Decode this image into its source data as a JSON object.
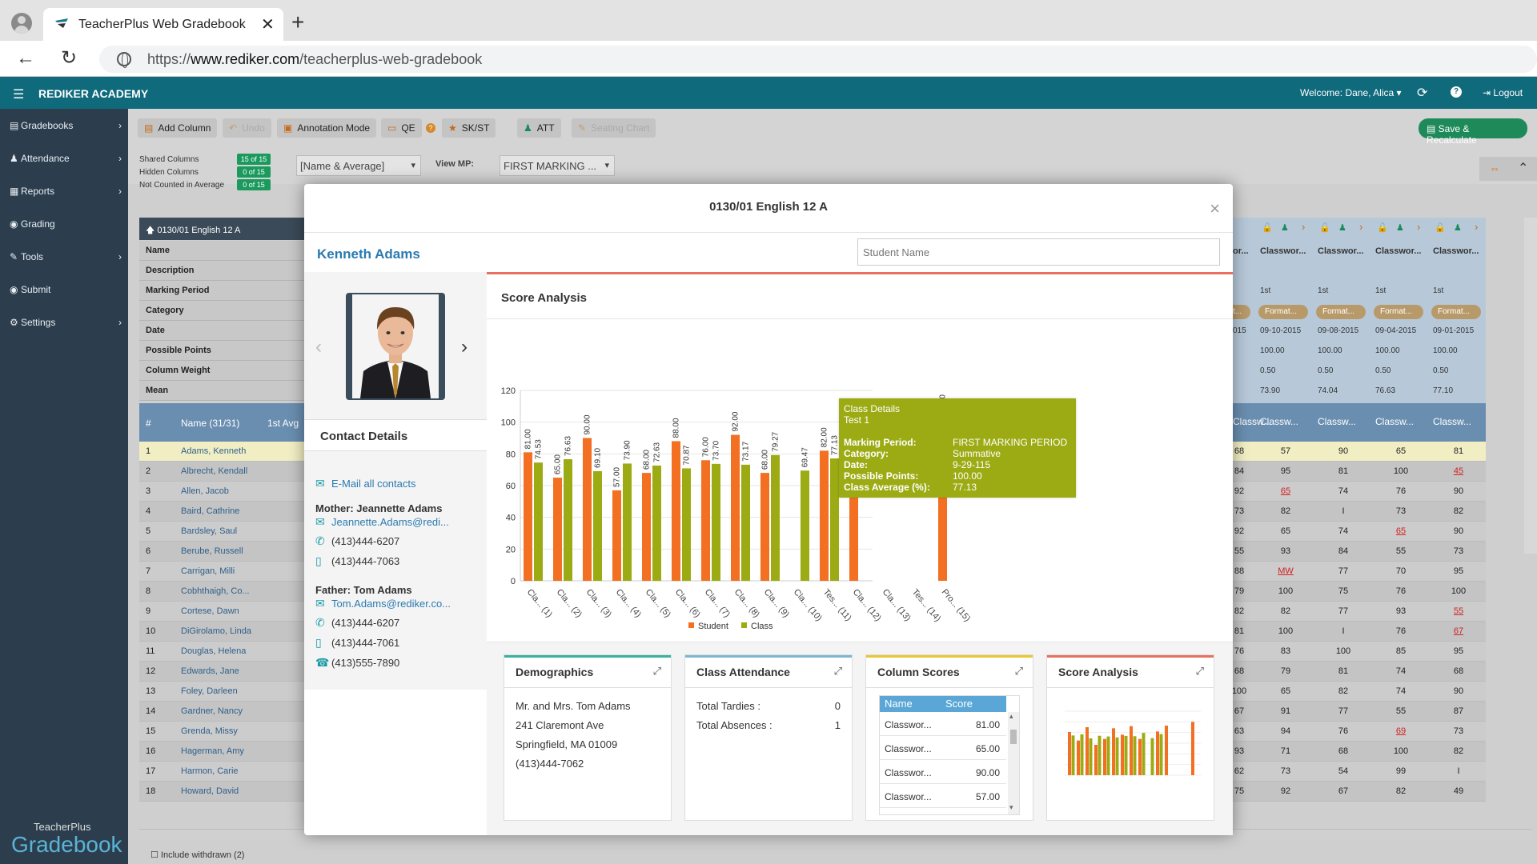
{
  "browser": {
    "tab_title": "TeacherPlus Web Gradebook - O",
    "url_prefix": "https://",
    "url_domain": "www.rediker.com",
    "url_path": "/teacherplus-web-gradebook"
  },
  "header": {
    "school": "REDIKER ACADEMY",
    "welcome": "Welcome: Dane, Alica ▾",
    "logout": "Logout"
  },
  "sidebar": {
    "items": [
      {
        "label": "Gradebooks",
        "icon": "book-icon",
        "glyph": "▤",
        "chevron": true
      },
      {
        "label": "Attendance",
        "icon": "user-icon",
        "glyph": "♟",
        "chevron": true
      },
      {
        "label": "Reports",
        "icon": "report-icon",
        "glyph": "▦",
        "chevron": true
      },
      {
        "label": "Grading",
        "icon": "grading-icon",
        "glyph": "◉",
        "chevron": false
      },
      {
        "label": "Tools",
        "icon": "wrench-icon",
        "glyph": "✎",
        "chevron": true
      },
      {
        "label": "Submit",
        "icon": "submit-icon",
        "glyph": "◉",
        "chevron": false
      },
      {
        "label": "Settings",
        "icon": "gear-icon",
        "glyph": "⚙",
        "chevron": true
      }
    ],
    "brand_small": "TeacherPlus",
    "brand_large": "Gradebook"
  },
  "toolbar": {
    "add_column": "Add Column",
    "undo": "Undo",
    "annotation": "Annotation Mode",
    "qe": "QE",
    "skst": "SK/ST",
    "att": "ATT",
    "seating": "Seating Chart",
    "save": "Save & Recalculate"
  },
  "options": {
    "shared_label": "Shared Columns",
    "shared_badge": "15 of 15",
    "hidden_label": "Hidden Columns",
    "hidden_badge": "0 of 15",
    "notcounted_label": "Not Counted in Average",
    "notcounted_badge": "0 of 15",
    "display_select": "[Name & Average]",
    "viewmp_label": "View MP:",
    "viewmp_select": "FIRST MARKING ..."
  },
  "grid": {
    "class_header": "0130/01 English 12 A",
    "row_labels": [
      "Name",
      "Description",
      "Marking Period",
      "Category",
      "Date",
      "Possible Points",
      "Column Weight",
      "Mean"
    ],
    "col_hash": "#",
    "col_name": "Name (31/31)",
    "col_avg": "1st Avg",
    "students": [
      {
        "n": "1",
        "name": "Adams, Kenneth"
      },
      {
        "n": "2",
        "name": "Albrecht, Kendall"
      },
      {
        "n": "3",
        "name": "Allen, Jacob"
      },
      {
        "n": "4",
        "name": "Baird, Cathrine"
      },
      {
        "n": "5",
        "name": "Bardsley, Saul"
      },
      {
        "n": "6",
        "name": "Berube, Russell"
      },
      {
        "n": "7",
        "name": "Carrigan, Milli"
      },
      {
        "n": "8",
        "name": "Cobhthaigh, Co..."
      },
      {
        "n": "9",
        "name": "Cortese, Dawn"
      },
      {
        "n": "10",
        "name": "DiGirolamo, Linda"
      },
      {
        "n": "11",
        "name": "Douglas, Helena"
      },
      {
        "n": "12",
        "name": "Edwards, Jane"
      },
      {
        "n": "13",
        "name": "Foley, Darleen"
      },
      {
        "n": "14",
        "name": "Gardner, Nancy"
      },
      {
        "n": "15",
        "name": "Grenda, Missy"
      },
      {
        "n": "16",
        "name": "Hagerman, Amy"
      },
      {
        "n": "17",
        "name": "Harmon, Carie"
      },
      {
        "n": "18",
        "name": "Howard, David"
      }
    ],
    "right_columns": [
      {
        "title": "Classwor...",
        "mp": "1st",
        "cat": "Format...",
        "date": "09-10-2015",
        "pts": "100.00",
        "wt": "0.50",
        "mean": "73.90",
        "head": "Classw..."
      },
      {
        "title": "Classwor...",
        "mp": "1st",
        "cat": "Format...",
        "date": "09-08-2015",
        "pts": "100.00",
        "wt": "0.50",
        "mean": "74.04",
        "head": "Classw..."
      },
      {
        "title": "Classwor...",
        "mp": "1st",
        "cat": "Format...",
        "date": "09-04-2015",
        "pts": "100.00",
        "wt": "0.50",
        "mean": "76.63",
        "head": "Classw..."
      },
      {
        "title": "Classwor...",
        "mp": "1st",
        "cat": "Format...",
        "date": "09-01-2015",
        "pts": "100.00",
        "wt": "0.50",
        "mean": "77.10",
        "head": "Classw..."
      }
    ],
    "partial_col": {
      "title": "or...",
      "cat": "t...",
      "date": "015",
      "head": "Classw..."
    },
    "partial_scores": [
      "68",
      "84",
      "92",
      "73",
      "92",
      "55",
      "88",
      "79",
      "82",
      "81",
      "76",
      "68",
      "100",
      "67",
      "63",
      "93",
      "62",
      "75"
    ],
    "scores": [
      [
        "57",
        "90",
        "65",
        "81"
      ],
      [
        "95",
        "81",
        "100",
        "45"
      ],
      [
        "65",
        "74",
        "76",
        "90"
      ],
      [
        "82",
        "I",
        "73",
        "82"
      ],
      [
        "65",
        "74",
        "65",
        "90"
      ],
      [
        "93",
        "84",
        "55",
        "73"
      ],
      [
        "MW",
        "77",
        "70",
        "95"
      ],
      [
        "100",
        "75",
        "76",
        "100"
      ],
      [
        "82",
        "77",
        "93",
        "55"
      ],
      [
        "100",
        "I",
        "76",
        "67"
      ],
      [
        "83",
        "100",
        "85",
        "95"
      ],
      [
        "79",
        "81",
        "74",
        "68"
      ],
      [
        "65",
        "82",
        "74",
        "90"
      ],
      [
        "91",
        "77",
        "55",
        "87"
      ],
      [
        "94",
        "76",
        "69",
        "73"
      ],
      [
        "71",
        "68",
        "100",
        "82"
      ],
      [
        "73",
        "54",
        "99",
        "I"
      ],
      [
        "92",
        "67",
        "82",
        "49"
      ]
    ],
    "include_withdrawn": "Include withdrawn (2)"
  },
  "modal": {
    "title": "0130/01 English 12 A",
    "student_name": "Kenneth Adams",
    "search_placeholder": "Student Name",
    "contact_header": "Contact Details",
    "email_all": "E-Mail all contacts",
    "mother_label": "Mother: Jeannette Adams",
    "mother_email": "Jeannette.Adams@redi...",
    "mother_phone1": "(413)444-6207",
    "mother_phone2": "(413)444-7063",
    "father_label": "Father: Tom Adams",
    "father_email": "Tom.Adams@rediker.co...",
    "father_phone1": "(413)444-6207",
    "father_phone2": "(413)444-7061",
    "father_phone3": "(413)555-7890",
    "score_analysis_title": "Score Analysis",
    "tooltip": {
      "title": "Class Details",
      "subtitle": "Test 1",
      "mp_label": "Marking Period:",
      "mp_value": "FIRST MARKING PERIOD",
      "cat_label": "Category:",
      "cat_value": "Summative",
      "date_label": "Date:",
      "date_value": "9-29-115",
      "pts_label": "Possible Points:",
      "pts_value": "100.00",
      "avg_label": "Class Average (%):",
      "avg_value": "77.13"
    },
    "cards": {
      "demographics": {
        "title": "Demographics",
        "line1": "Mr. and Mrs. Tom Adams",
        "line2": "241 Claremont Ave",
        "line3": "Springfield, MA 01009",
        "line4": "(413)444-7062"
      },
      "attendance": {
        "title": "Class Attendance",
        "tardies_label": "Total Tardies :",
        "tardies": "0",
        "absences_label": "Total Absences :",
        "absences": "1"
      },
      "column_scores": {
        "title": "Column Scores",
        "col_name": "Name",
        "col_score": "Score",
        "rows": [
          [
            "Classwor...",
            "81.00"
          ],
          [
            "Classwor...",
            "65.00"
          ],
          [
            "Classwor...",
            "90.00"
          ],
          [
            "Classwor...",
            "57.00"
          ]
        ]
      },
      "score_analysis": {
        "title": "Score Analysis"
      }
    }
  },
  "colors": {
    "accent": "#0f6a7c",
    "student": "#f36f21",
    "class": "#9cab14",
    "link": "#2a7ab0"
  },
  "chart_data": {
    "type": "bar",
    "categories": [
      "Cla... (1)",
      "Cla... (2)",
      "Cla... (3)",
      "Cla... (4)",
      "Cla... (5)",
      "Cla... (6)",
      "Cla... (7)",
      "Cla... (8)",
      "Cla... (9)",
      "Cla... (10)",
      "Tes... (11)",
      "Cla... (12)",
      "Cla... (13)",
      "Tes... (14)",
      "Pro... (15)"
    ],
    "series": [
      {
        "name": "Student",
        "color": "#f36f21",
        "values": [
          81.0,
          65.0,
          90.0,
          57.0,
          68.0,
          88.0,
          76.0,
          92.0,
          68.0,
          null,
          82.0,
          93.0,
          null,
          null,
          100.0
        ]
      },
      {
        "name": "Class",
        "color": "#9cab14",
        "values": [
          74.53,
          76.63,
          69.1,
          73.9,
          72.63,
          70.87,
          73.7,
          73.17,
          79.27,
          69.47,
          77.13,
          null,
          null,
          null,
          null
        ]
      }
    ],
    "ylim": [
      0,
      120
    ],
    "yticks": [
      0,
      20,
      40,
      60,
      80,
      100,
      120
    ],
    "title": "",
    "xlabel": "",
    "ylabel": "",
    "legend": "bottom"
  }
}
